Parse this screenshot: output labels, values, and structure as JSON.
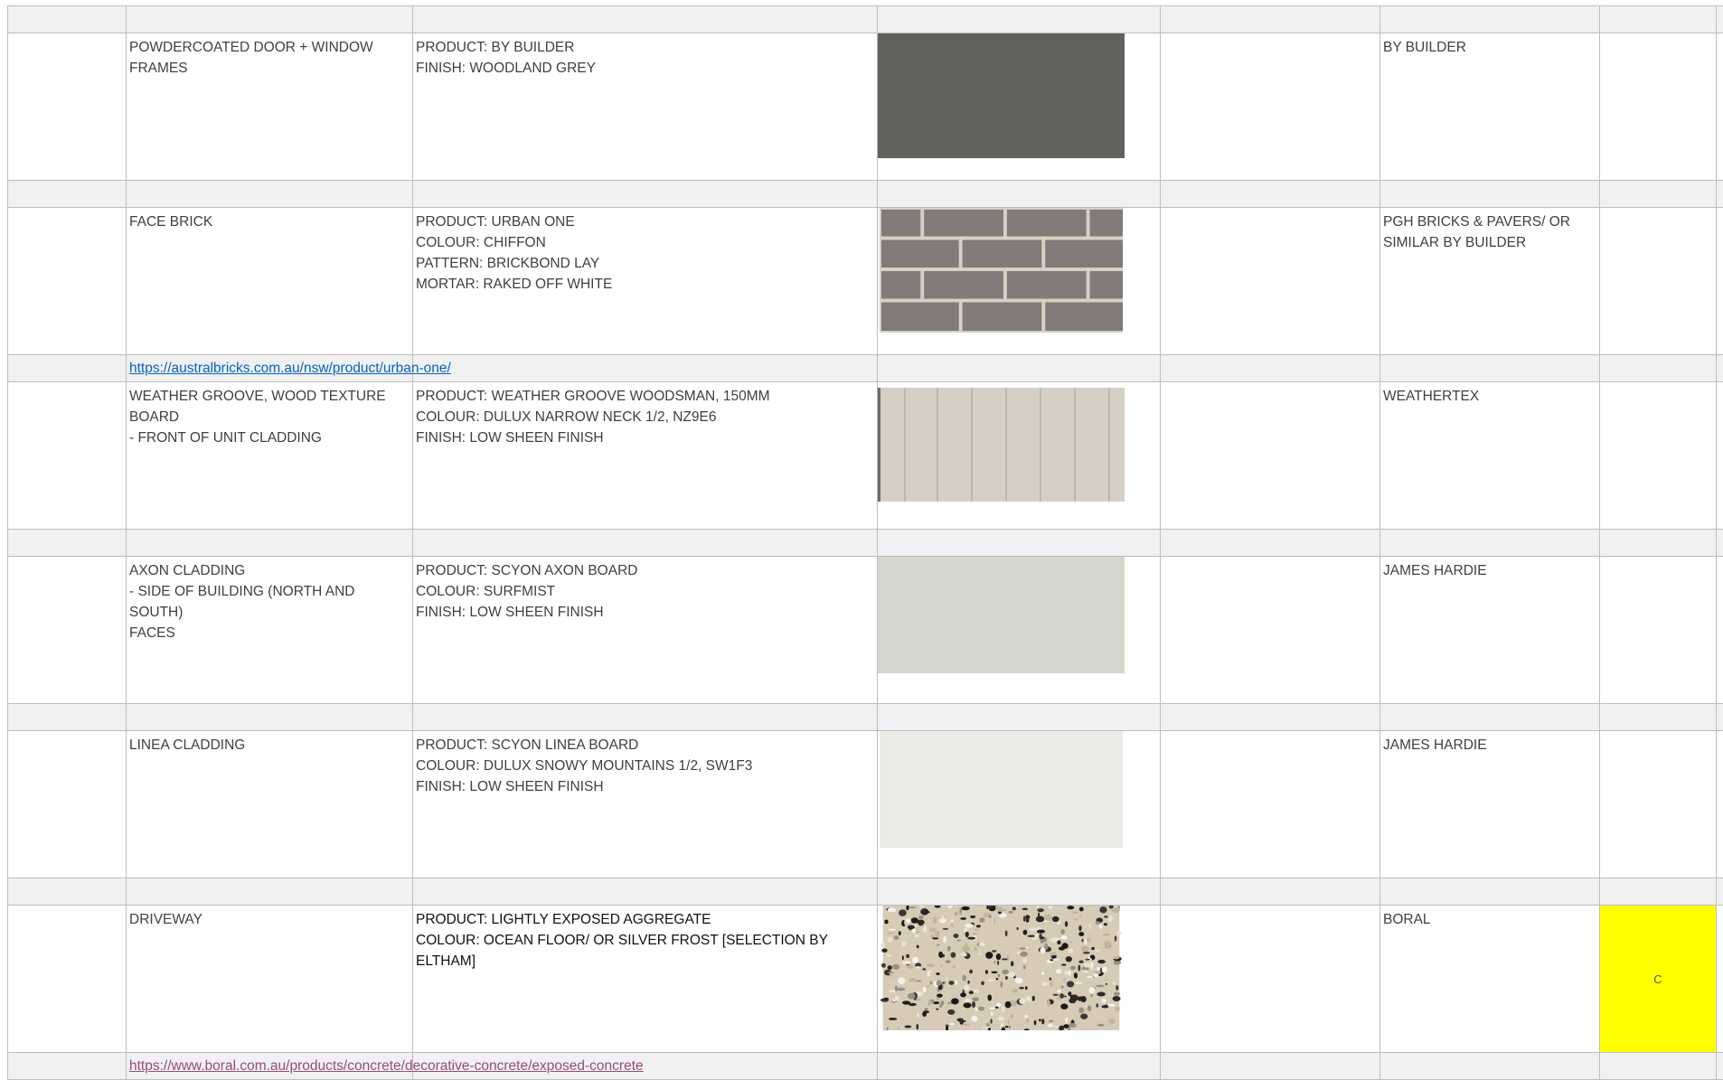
{
  "rows": [
    {
      "element": [
        "POWDERCOATED DOOR + WINDOW",
        "FRAMES"
      ],
      "spec": [
        "PRODUCT: BY BUILDER",
        "FINISH: WOODLAND GREY"
      ],
      "supplier": [
        "BY BUILDER"
      ],
      "swatch": "woodland-grey"
    },
    {
      "element": [
        "FACE BRICK"
      ],
      "spec": [
        "PRODUCT: URBAN ONE",
        "COLOUR: CHIFFON",
        "PATTERN: BRICKBOND LAY",
        "MORTAR: RAKED OFF WHITE"
      ],
      "supplier": [
        "PGH BRICKS & PAVERS/ OR",
        "SIMILAR BY BUILDER"
      ],
      "swatch": "brick",
      "link": "https://australbricks.com.au/nsw/product/urban-one/"
    },
    {
      "element": [
        "WEATHER GROOVE, WOOD TEXTURE",
        "BOARD",
        "- FRONT OF UNIT CLADDING"
      ],
      "spec": [
        "PRODUCT: WEATHER GROOVE WOODSMAN, 150MM",
        "COLOUR: DULUX NARROW NECK 1/2, NZ9E6",
        "FINISH: LOW SHEEN FINISH"
      ],
      "supplier": [
        "WEATHERTEX"
      ],
      "swatch": "weathergroove"
    },
    {
      "element": [
        "AXON CLADDING",
        "- SIDE OF BUILDING (NORTH AND SOUTH)",
        "FACES"
      ],
      "spec": [
        "PRODUCT: SCYON AXON BOARD",
        "COLOUR: SURFMIST",
        "FINISH: LOW SHEEN FINISH"
      ],
      "supplier": [
        "JAMES HARDIE"
      ],
      "swatch": "surfmist"
    },
    {
      "element": [
        "LINEA CLADDING"
      ],
      "spec": [
        "PRODUCT: SCYON LINEA BOARD",
        "COLOUR: DULUX SNOWY MOUNTAINS 1/2, SW1F3",
        "FINISH: LOW SHEEN FINISH"
      ],
      "supplier": [
        "JAMES HARDIE"
      ],
      "swatch": "snowy-mountains"
    },
    {
      "element": [
        "DRIVEWAY"
      ],
      "spec": [
        "PRODUCT: LIGHTLY EXPOSED AGGREGATE",
        "COLOUR: OCEAN FLOOR/ OR SILVER FROST [SELECTION BY ELTHAM]"
      ],
      "supplier": [
        "BORAL"
      ],
      "swatch": "aggregate",
      "status_cell": "C",
      "link": "https://www.boral.com.au/products/concrete/decorative-concrete/exposed-concrete"
    }
  ],
  "colors": {
    "gridline": "#bdbdbd",
    "spacer_fill": "#f1f1f1",
    "link_unvisited": "#0563c1",
    "link_visited": "#954f72",
    "status_highlight": "#ffff00",
    "woodland_grey": "#62615c",
    "surfmist": "#d6d6ce",
    "snowy_mountains": "#ecece6"
  }
}
